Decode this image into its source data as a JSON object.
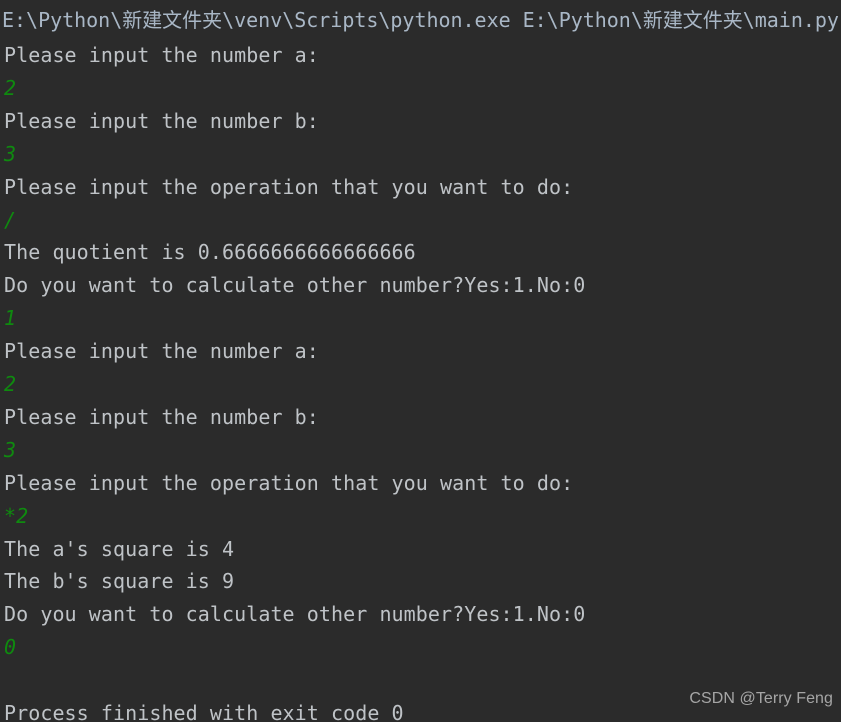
{
  "window": {
    "title": "Run - main.py",
    "background_color": "#2b2b2b",
    "output_text_color": "#bbbbbb",
    "input_echo_color": "#0f8a0f",
    "command_line_color": "#a9b7c6"
  },
  "console": {
    "lines": [
      {
        "kind": "cmd",
        "text": "E:\\Python\\新建文件夹\\venv\\Scripts\\python.exe E:\\Python\\新建文件夹\\main.py"
      },
      {
        "kind": "out",
        "text": "Please input the number a:"
      },
      {
        "kind": "inp",
        "text": "2"
      },
      {
        "kind": "out",
        "text": "Please input the number b:"
      },
      {
        "kind": "inp",
        "text": "3"
      },
      {
        "kind": "out",
        "text": "Please input the operation that you want to do:"
      },
      {
        "kind": "inp",
        "text": "/"
      },
      {
        "kind": "out",
        "text": "The quotient is 0.6666666666666666"
      },
      {
        "kind": "out",
        "text": "Do you want to calculate other number?Yes:1.No:0"
      },
      {
        "kind": "inp",
        "text": "1"
      },
      {
        "kind": "out",
        "text": "Please input the number a:"
      },
      {
        "kind": "inp",
        "text": "2"
      },
      {
        "kind": "out",
        "text": "Please input the number b:"
      },
      {
        "kind": "inp",
        "text": "3"
      },
      {
        "kind": "out",
        "text": "Please input the operation that you want to do:"
      },
      {
        "kind": "inp",
        "text": "*2"
      },
      {
        "kind": "out",
        "text": "The a's square is 4"
      },
      {
        "kind": "out",
        "text": "The b's square is 9"
      },
      {
        "kind": "out",
        "text": "Do you want to calculate other number?Yes:1.No:0"
      },
      {
        "kind": "inp",
        "text": "0"
      },
      {
        "kind": "blank",
        "text": ""
      },
      {
        "kind": "out",
        "text": "Process finished with exit code 0"
      }
    ]
  },
  "watermark": {
    "text": "CSDN @Terry Feng"
  }
}
